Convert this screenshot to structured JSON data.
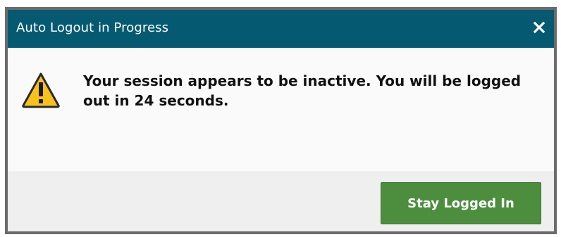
{
  "dialog": {
    "title": "Auto Logout in Progress",
    "close_icon": "close-icon",
    "message": "Your session appears to be inactive. You will be logged out in 24 seconds.",
    "warning_icon": "warning-icon",
    "primary_button_label": "Stay Logged In"
  },
  "colors": {
    "titlebar": "#055a72",
    "button": "#4c8e3e",
    "warning_fill": "#f6c21b",
    "frame_border": "#6b6b6b"
  }
}
